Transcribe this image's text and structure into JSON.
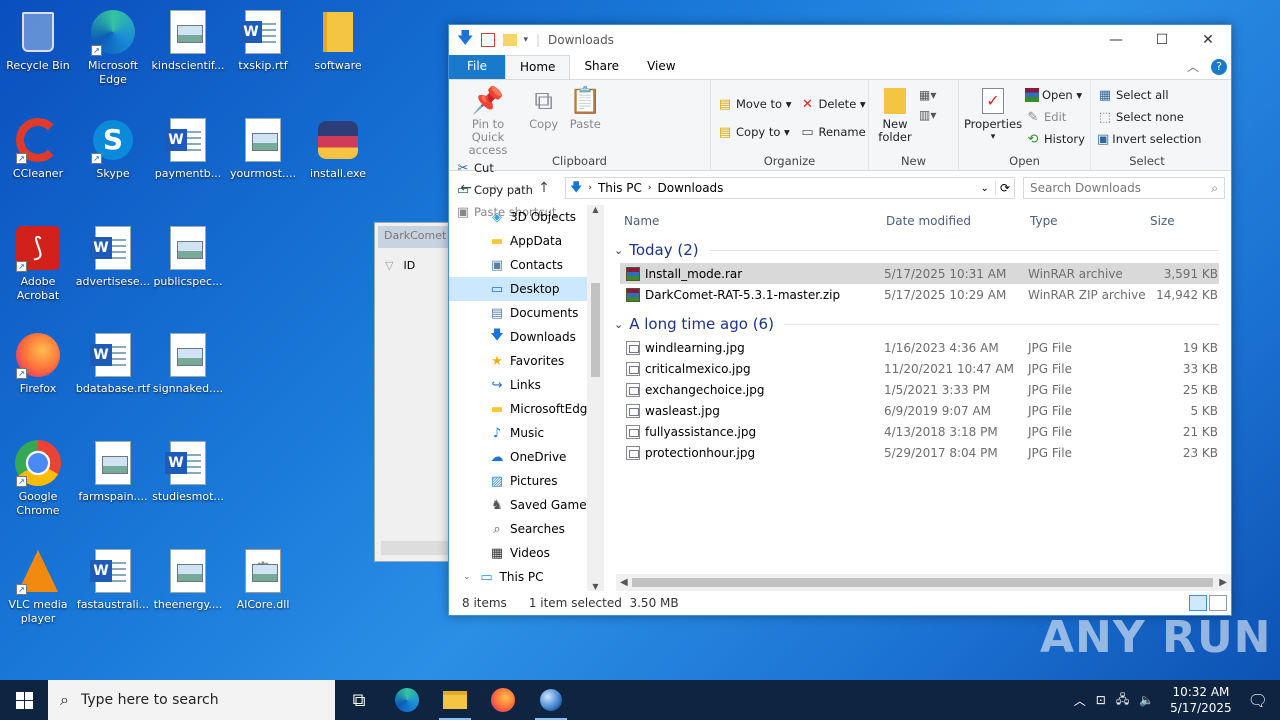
{
  "desktop": {
    "icons": [
      {
        "label": "Recycle Bin",
        "icon": "recycle-bin-icon"
      },
      {
        "label": "Microsoft Edge",
        "icon": "edge-icon"
      },
      {
        "label": "kindscientif...",
        "icon": "image-file-icon"
      },
      {
        "label": "txskip.rtf",
        "icon": "word-file-icon"
      },
      {
        "label": "software",
        "icon": "folder-icon"
      },
      {
        "label": "CCleaner",
        "icon": "ccleaner-icon"
      },
      {
        "label": "Skype",
        "icon": "skype-icon"
      },
      {
        "label": "paymentb...",
        "icon": "word-file-icon"
      },
      {
        "label": "yourmost....",
        "icon": "image-file-icon"
      },
      {
        "label": "install.exe",
        "icon": "installer-icon"
      },
      {
        "label": "Adobe Acrobat",
        "icon": "acrobat-icon"
      },
      {
        "label": "advertisese...",
        "icon": "word-file-icon"
      },
      {
        "label": "publicspec...",
        "icon": "image-file-icon"
      },
      {
        "label": "Firefox",
        "icon": "firefox-icon"
      },
      {
        "label": "bdatabase.rtf",
        "icon": "word-file-icon"
      },
      {
        "label": "signnaked....",
        "icon": "image-file-icon"
      },
      {
        "label": "Google Chrome",
        "icon": "chrome-icon"
      },
      {
        "label": "farmspain....",
        "icon": "image-file-icon"
      },
      {
        "label": "studiesmot...",
        "icon": "word-file-icon"
      },
      {
        "label": "VLC media player",
        "icon": "vlc-icon"
      },
      {
        "label": "fastaustrali...",
        "icon": "word-file-icon"
      },
      {
        "label": "theenergy....",
        "icon": "image-file-icon"
      },
      {
        "label": "AICore.dll",
        "icon": "dll-file-icon"
      }
    ]
  },
  "ghost_window": {
    "title": "DarkComet",
    "col": "ID"
  },
  "explorer": {
    "title": "Downloads",
    "tabs": {
      "file": "File",
      "home": "Home",
      "share": "Share",
      "view": "View"
    },
    "ribbon": {
      "clipboard": {
        "pin": "Pin to Quick access",
        "copy": "Copy",
        "paste": "Paste",
        "cut": "Cut",
        "copy_path": "Copy path",
        "paste_shortcut": "Paste shortcut",
        "label": "Clipboard"
      },
      "organize": {
        "move_to": "Move to",
        "copy_to": "Copy to",
        "delete": "Delete",
        "rename": "Rename",
        "label": "Organize"
      },
      "new": {
        "new_folder": "New folder",
        "label": "New"
      },
      "open": {
        "properties": "Properties",
        "open": "Open",
        "edit": "Edit",
        "history": "History",
        "label": "Open"
      },
      "select": {
        "select_all": "Select all",
        "select_none": "Select none",
        "invert": "Invert selection",
        "label": "Select"
      }
    },
    "address": {
      "this_pc": "This PC",
      "downloads": "Downloads"
    },
    "search_placeholder": "Search Downloads",
    "tree": [
      {
        "label": "3D Objects",
        "icon": "3d-objects-icon"
      },
      {
        "label": "AppData",
        "icon": "folder-icon"
      },
      {
        "label": "Contacts",
        "icon": "contacts-icon"
      },
      {
        "label": "Desktop",
        "icon": "desktop-icon",
        "selected": true
      },
      {
        "label": "Documents",
        "icon": "documents-icon"
      },
      {
        "label": "Downloads",
        "icon": "downloads-icon"
      },
      {
        "label": "Favorites",
        "icon": "star-icon"
      },
      {
        "label": "Links",
        "icon": "links-icon"
      },
      {
        "label": "MicrosoftEdge",
        "icon": "folder-icon"
      },
      {
        "label": "Music",
        "icon": "music-icon"
      },
      {
        "label": "OneDrive",
        "icon": "onedrive-icon"
      },
      {
        "label": "Pictures",
        "icon": "pictures-icon"
      },
      {
        "label": "Saved Games",
        "icon": "saved-games-icon"
      },
      {
        "label": "Searches",
        "icon": "searches-icon"
      },
      {
        "label": "Videos",
        "icon": "videos-icon"
      },
      {
        "label": "This PC",
        "icon": "this-pc-icon"
      }
    ],
    "columns": {
      "name": "Name",
      "date": "Date modified",
      "type": "Type",
      "size": "Size"
    },
    "groups": [
      {
        "title": "Today (2)",
        "files": [
          {
            "name": "Install_mode.rar",
            "date": "5/17/2025 10:31 AM",
            "type": "WinRAR archive",
            "size": "3,591 KB",
            "kind": "rar",
            "selected": true
          },
          {
            "name": "DarkComet-RAT-5.3.1-master.zip",
            "date": "5/17/2025 10:29 AM",
            "type": "WinRAR ZIP archive",
            "size": "14,942 KB",
            "kind": "rar"
          }
        ]
      },
      {
        "title": "A long time ago (6)",
        "files": [
          {
            "name": "windlearning.jpg",
            "date": "1/16/2023 4:36 AM",
            "type": "JPG File",
            "size": "19 KB",
            "kind": "jpg"
          },
          {
            "name": "criticalmexico.jpg",
            "date": "11/20/2021 10:47 AM",
            "type": "JPG File",
            "size": "33 KB",
            "kind": "jpg"
          },
          {
            "name": "exchangechoice.jpg",
            "date": "1/5/2021 3:33 PM",
            "type": "JPG File",
            "size": "25 KB",
            "kind": "jpg"
          },
          {
            "name": "wasleast.jpg",
            "date": "6/9/2019 9:07 AM",
            "type": "JPG File",
            "size": "5 KB",
            "kind": "jpg"
          },
          {
            "name": "fullyassistance.jpg",
            "date": "4/13/2018 3:18 PM",
            "type": "JPG File",
            "size": "21 KB",
            "kind": "jpg"
          },
          {
            "name": "protectionhour.jpg",
            "date": "5/29/2017 8:04 PM",
            "type": "JPG File",
            "size": "23 KB",
            "kind": "jpg"
          }
        ]
      }
    ],
    "status": {
      "items": "8 items",
      "selected": "1 item selected",
      "size": "3.50 MB"
    }
  },
  "taskbar": {
    "search_placeholder": "Type here to search",
    "time": "10:32 AM",
    "date": "5/17/2025"
  },
  "watermark": "ANY RUN"
}
